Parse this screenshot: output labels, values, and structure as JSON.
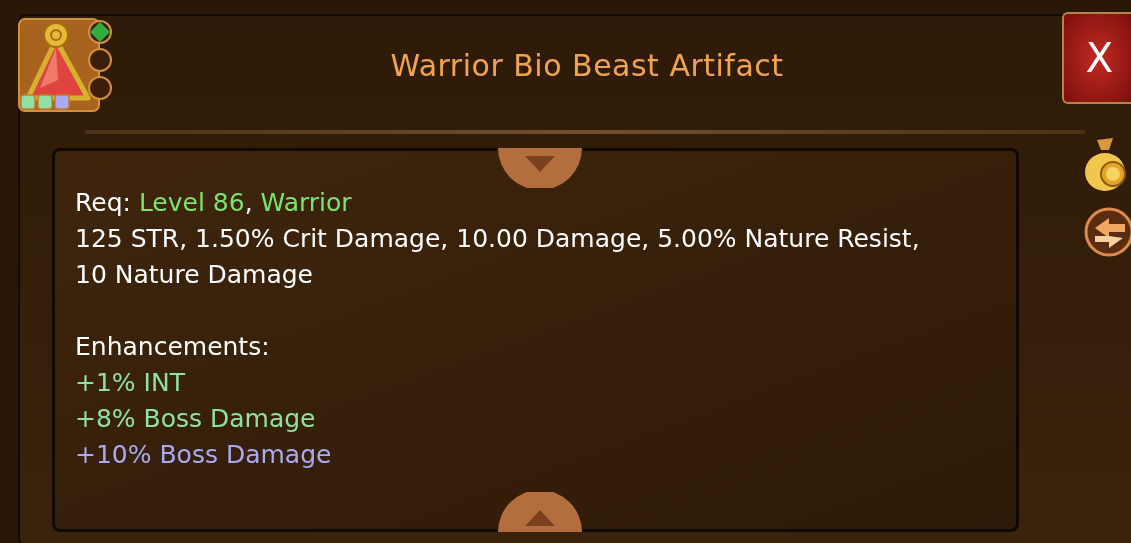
{
  "item": {
    "title": "Warrior Bio Beast Artifact",
    "sockets": [
      {
        "filled": true,
        "color": "#2fae3c"
      },
      {
        "filled": false
      },
      {
        "filled": false
      }
    ],
    "enhancement_marks": [
      {
        "color": "#8ee0a4"
      },
      {
        "color": "#8ee0a4"
      },
      {
        "color": "#a9a9f4"
      }
    ]
  },
  "close_button": {
    "label": "X"
  },
  "details": {
    "requirements": [
      {
        "text": "Req: ",
        "highlight": false
      },
      {
        "text": "Level 86",
        "highlight": true
      },
      {
        "text": ", ",
        "highlight": false
      },
      {
        "text": "Warrior",
        "highlight": true
      }
    ],
    "stats": "125 STR, 1.50% Crit Damage, 10.00 Damage, 5.00% Nature Resist, 10 Nature Damage",
    "enhancements_heading": "Enhancements:",
    "enhancements": [
      {
        "text": "+1% INT",
        "color": "#8ee0a4"
      },
      {
        "text": "+8% Boss Damage",
        "color": "#8ee0a4"
      },
      {
        "text": "+10% Boss Damage",
        "color": "#a9a9f4"
      }
    ]
  }
}
